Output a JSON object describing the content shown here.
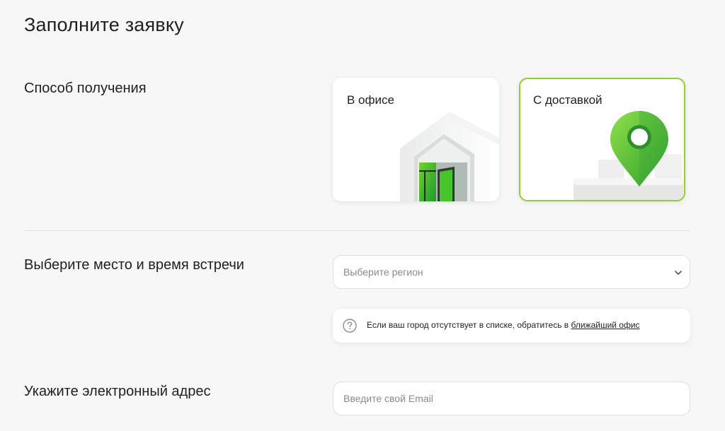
{
  "page": {
    "title": "Заполните заявку"
  },
  "delivery": {
    "label": "Способ получения",
    "options": [
      {
        "label": "В офисе",
        "selected": false
      },
      {
        "label": "С доставкой",
        "selected": true
      }
    ]
  },
  "meeting": {
    "label": "Выберите место и время встречи",
    "region_placeholder": "Выберите регион",
    "hint_text": "Если ваш город отсутствует в списке, обратитесь в ",
    "hint_link": "ближайший офис"
  },
  "email": {
    "label": "Укажите электронный адрес",
    "placeholder": "Введите свой Email"
  },
  "colors": {
    "accent": "#8fce3a",
    "brand_green": "#21a038",
    "background": "#f7f7f7"
  },
  "icons": {
    "office": "house-door-icon",
    "delivery": "map-pin-icon",
    "dropdown": "chevron-down-icon",
    "hint": "question-circle-icon"
  }
}
